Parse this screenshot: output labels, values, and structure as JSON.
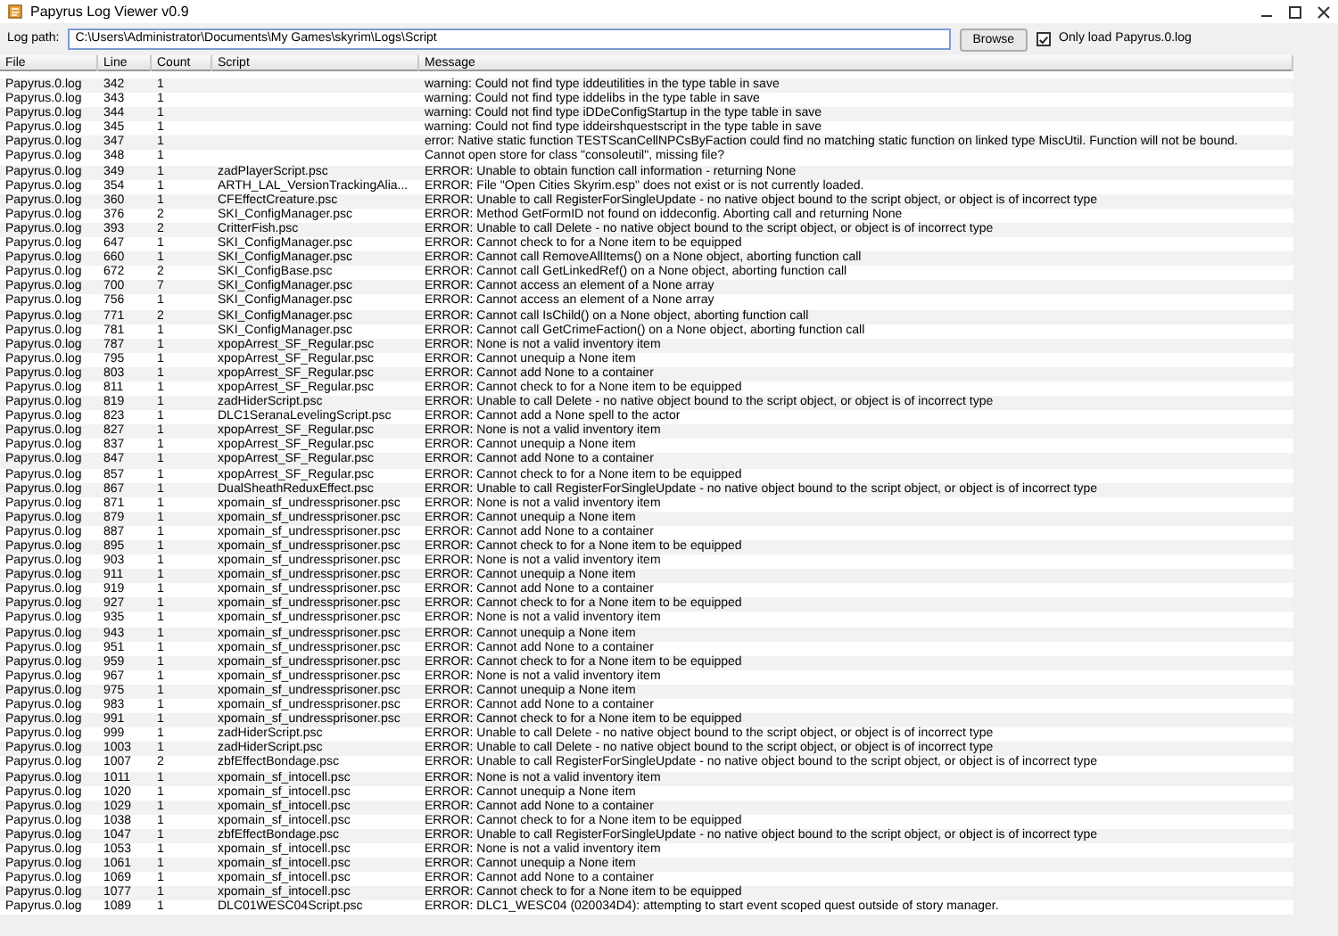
{
  "window": {
    "title": "Papyrus Log Viewer v0.9"
  },
  "toolbar": {
    "label": "Log path:",
    "path": "C:\\Users\\Administrator\\Documents\\My Games\\skyrim\\Logs\\Script",
    "browse": "Browse",
    "only_load": {
      "label": "Only load Papyrus.0.log",
      "checked": true
    }
  },
  "table": {
    "columns": [
      "File",
      "Line",
      "Count",
      "Script",
      "Message"
    ],
    "rows": [
      {
        "file": "Papyrus.0.log",
        "line": "342",
        "count": "1",
        "message": "warning: Could not find type iddeutilities in the type table in save"
      },
      {
        "file": "Papyrus.0.log",
        "line": "343",
        "count": "1",
        "message": "warning: Could not find type iddelibs in the type table in save"
      },
      {
        "file": "Papyrus.0.log",
        "line": "344",
        "count": "1",
        "message": "warning: Could not find type iDDeConfigStartup in the type table in save"
      },
      {
        "file": "Papyrus.0.log",
        "line": "345",
        "count": "1",
        "message": "warning: Could not find type iddeirshquestscript in the type table in save"
      },
      {
        "file": "Papyrus.0.log",
        "line": "347",
        "count": "1",
        "message": "error: Native static function TESTScanCellNPCsByFaction could find no matching static function on linked type MiscUtil. Function will not be bound."
      },
      {
        "file": "Papyrus.0.log",
        "line": "348",
        "count": "1",
        "message": "Cannot open store for class \"consoleutil\", missing file?"
      },
      {
        "file": "Papyrus.0.log",
        "line": "349",
        "count": "1",
        "script": "zadPlayerScript.psc",
        "message": "ERROR: Unable to obtain function call information - returning None"
      },
      {
        "file": "Papyrus.0.log",
        "line": "354",
        "count": "1",
        "script": "ARTH_LAL_VersionTrackingAlia...",
        "message": "ERROR: File \"Open Cities Skyrim.esp\" does not exist or is not currently loaded."
      },
      {
        "file": "Papyrus.0.log",
        "line": "360",
        "count": "1",
        "script": "CFEffectCreature.psc",
        "message": "ERROR: Unable to call RegisterForSingleUpdate - no native object bound to the script object, or object is of incorrect type"
      },
      {
        "file": "Papyrus.0.log",
        "line": "376",
        "count": "2",
        "script": "SKI_ConfigManager.psc",
        "message": "ERROR: Method GetFormID not found on iddeconfig. Aborting call and returning None"
      },
      {
        "file": "Papyrus.0.log",
        "line": "393",
        "count": "2",
        "script": "CritterFish.psc",
        "message": "ERROR: Unable to call Delete - no native object bound to the script object, or object is of incorrect type"
      },
      {
        "file": "Papyrus.0.log",
        "line": "647",
        "count": "1",
        "script": "SKI_ConfigManager.psc",
        "message": "ERROR: Cannot check to for a None item to be equipped"
      },
      {
        "file": "Papyrus.0.log",
        "line": "660",
        "count": "1",
        "script": "SKI_ConfigManager.psc",
        "message": "ERROR: Cannot call RemoveAllItems() on a None object, aborting function call"
      },
      {
        "file": "Papyrus.0.log",
        "line": "672",
        "count": "2",
        "script": "SKI_ConfigBase.psc",
        "message": "ERROR: Cannot call GetLinkedRef() on a None object, aborting function call"
      },
      {
        "file": "Papyrus.0.log",
        "line": "700",
        "count": "7",
        "script": "SKI_ConfigManager.psc",
        "message": "ERROR: Cannot access an element of a None array"
      },
      {
        "file": "Papyrus.0.log",
        "line": "756",
        "count": "1",
        "script": "SKI_ConfigManager.psc",
        "message": "ERROR: Cannot access an element of a None array"
      },
      {
        "file": "Papyrus.0.log",
        "line": "771",
        "count": "2",
        "script": "SKI_ConfigManager.psc",
        "message": "ERROR: Cannot call IsChild() on a None object, aborting function call"
      },
      {
        "file": "Papyrus.0.log",
        "line": "781",
        "count": "1",
        "script": "SKI_ConfigManager.psc",
        "message": "ERROR: Cannot call GetCrimeFaction() on a None object, aborting function call"
      },
      {
        "file": "Papyrus.0.log",
        "line": "787",
        "count": "1",
        "script": "xpopArrest_SF_Regular.psc",
        "message": "ERROR: None is not a valid inventory item"
      },
      {
        "file": "Papyrus.0.log",
        "line": "795",
        "count": "1",
        "script": "xpopArrest_SF_Regular.psc",
        "message": "ERROR: Cannot unequip a None item"
      },
      {
        "file": "Papyrus.0.log",
        "line": "803",
        "count": "1",
        "script": "xpopArrest_SF_Regular.psc",
        "message": "ERROR: Cannot add None to a container"
      },
      {
        "file": "Papyrus.0.log",
        "line": "811",
        "count": "1",
        "script": "xpopArrest_SF_Regular.psc",
        "message": "ERROR: Cannot check to for a None item to be equipped"
      },
      {
        "file": "Papyrus.0.log",
        "line": "819",
        "count": "1",
        "script": "zadHiderScript.psc",
        "message": "ERROR: Unable to call Delete - no native object bound to the script object, or object is of incorrect type"
      },
      {
        "file": "Papyrus.0.log",
        "line": "823",
        "count": "1",
        "script": "DLC1SeranaLevelingScript.psc",
        "message": "ERROR: Cannot add a None spell to the actor"
      },
      {
        "file": "Papyrus.0.log",
        "line": "827",
        "count": "1",
        "script": "xpopArrest_SF_Regular.psc",
        "message": "ERROR: None is not a valid inventory item"
      },
      {
        "file": "Papyrus.0.log",
        "line": "837",
        "count": "1",
        "script": "xpopArrest_SF_Regular.psc",
        "message": "ERROR: Cannot unequip a None item"
      },
      {
        "file": "Papyrus.0.log",
        "line": "847",
        "count": "1",
        "script": "xpopArrest_SF_Regular.psc",
        "message": "ERROR: Cannot add None to a container"
      },
      {
        "file": "Papyrus.0.log",
        "line": "857",
        "count": "1",
        "script": "xpopArrest_SF_Regular.psc",
        "message": "ERROR: Cannot check to for a None item to be equipped"
      },
      {
        "file": "Papyrus.0.log",
        "line": "867",
        "count": "1",
        "script": "DualSheathReduxEffect.psc",
        "message": "ERROR: Unable to call RegisterForSingleUpdate - no native object bound to the script object, or object is of incorrect type"
      },
      {
        "file": "Papyrus.0.log",
        "line": "871",
        "count": "1",
        "script": "xpomain_sf_undressprisoner.psc",
        "message": "ERROR: None is not a valid inventory item"
      },
      {
        "file": "Papyrus.0.log",
        "line": "879",
        "count": "1",
        "script": "xpomain_sf_undressprisoner.psc",
        "message": "ERROR: Cannot unequip a None item"
      },
      {
        "file": "Papyrus.0.log",
        "line": "887",
        "count": "1",
        "script": "xpomain_sf_undressprisoner.psc",
        "message": "ERROR: Cannot add None to a container"
      },
      {
        "file": "Papyrus.0.log",
        "line": "895",
        "count": "1",
        "script": "xpomain_sf_undressprisoner.psc",
        "message": "ERROR: Cannot check to for a None item to be equipped"
      },
      {
        "file": "Papyrus.0.log",
        "line": "903",
        "count": "1",
        "script": "xpomain_sf_undressprisoner.psc",
        "message": "ERROR: None is not a valid inventory item"
      },
      {
        "file": "Papyrus.0.log",
        "line": "911",
        "count": "1",
        "script": "xpomain_sf_undressprisoner.psc",
        "message": "ERROR: Cannot unequip a None item"
      },
      {
        "file": "Papyrus.0.log",
        "line": "919",
        "count": "1",
        "script": "xpomain_sf_undressprisoner.psc",
        "message": "ERROR: Cannot add None to a container"
      },
      {
        "file": "Papyrus.0.log",
        "line": "927",
        "count": "1",
        "script": "xpomain_sf_undressprisoner.psc",
        "message": "ERROR: Cannot check to for a None item to be equipped"
      },
      {
        "file": "Papyrus.0.log",
        "line": "935",
        "count": "1",
        "script": "xpomain_sf_undressprisoner.psc",
        "message": "ERROR: None is not a valid inventory item"
      },
      {
        "file": "Papyrus.0.log",
        "line": "943",
        "count": "1",
        "script": "xpomain_sf_undressprisoner.psc",
        "message": "ERROR: Cannot unequip a None item"
      },
      {
        "file": "Papyrus.0.log",
        "line": "951",
        "count": "1",
        "script": "xpomain_sf_undressprisoner.psc",
        "message": "ERROR: Cannot add None to a container"
      },
      {
        "file": "Papyrus.0.log",
        "line": "959",
        "count": "1",
        "script": "xpomain_sf_undressprisoner.psc",
        "message": "ERROR: Cannot check to for a None item to be equipped"
      },
      {
        "file": "Papyrus.0.log",
        "line": "967",
        "count": "1",
        "script": "xpomain_sf_undressprisoner.psc",
        "message": "ERROR: None is not a valid inventory item"
      },
      {
        "file": "Papyrus.0.log",
        "line": "975",
        "count": "1",
        "script": "xpomain_sf_undressprisoner.psc",
        "message": "ERROR: Cannot unequip a None item"
      },
      {
        "file": "Papyrus.0.log",
        "line": "983",
        "count": "1",
        "script": "xpomain_sf_undressprisoner.psc",
        "message": "ERROR: Cannot add None to a container"
      },
      {
        "file": "Papyrus.0.log",
        "line": "991",
        "count": "1",
        "script": "xpomain_sf_undressprisoner.psc",
        "message": "ERROR: Cannot check to for a None item to be equipped"
      },
      {
        "file": "Papyrus.0.log",
        "line": "999",
        "count": "1",
        "script": "zadHiderScript.psc",
        "message": "ERROR: Unable to call Delete - no native object bound to the script object, or object is of incorrect type"
      },
      {
        "file": "Papyrus.0.log",
        "line": "1003",
        "count": "1",
        "script": "zadHiderScript.psc",
        "message": "ERROR: Unable to call Delete - no native object bound to the script object, or object is of incorrect type"
      },
      {
        "file": "Papyrus.0.log",
        "line": "1007",
        "count": "2",
        "script": "zbfEffectBondage.psc",
        "message": "ERROR: Unable to call RegisterForSingleUpdate - no native object bound to the script object, or object is of incorrect type"
      },
      {
        "file": "Papyrus.0.log",
        "line": "1011",
        "count": "1",
        "script": "xpomain_sf_intocell.psc",
        "message": "ERROR: None is not a valid inventory item"
      },
      {
        "file": "Papyrus.0.log",
        "line": "1020",
        "count": "1",
        "script": "xpomain_sf_intocell.psc",
        "message": "ERROR: Cannot unequip a None item"
      },
      {
        "file": "Papyrus.0.log",
        "line": "1029",
        "count": "1",
        "script": "xpomain_sf_intocell.psc",
        "message": "ERROR: Cannot add None to a container"
      },
      {
        "file": "Papyrus.0.log",
        "line": "1038",
        "count": "1",
        "script": "xpomain_sf_intocell.psc",
        "message": "ERROR: Cannot check to for a None item to be equipped"
      },
      {
        "file": "Papyrus.0.log",
        "line": "1047",
        "count": "1",
        "script": "zbfEffectBondage.psc",
        "message": "ERROR: Unable to call RegisterForSingleUpdate - no native object bound to the script object, or object is of incorrect type"
      },
      {
        "file": "Papyrus.0.log",
        "line": "1053",
        "count": "1",
        "script": "xpomain_sf_intocell.psc",
        "message": "ERROR: None is not a valid inventory item"
      },
      {
        "file": "Papyrus.0.log",
        "line": "1061",
        "count": "1",
        "script": "xpomain_sf_intocell.psc",
        "message": "ERROR: Cannot unequip a None item"
      },
      {
        "file": "Papyrus.0.log",
        "line": "1069",
        "count": "1",
        "script": "xpomain_sf_intocell.psc",
        "message": "ERROR: Cannot add None to a container"
      },
      {
        "file": "Papyrus.0.log",
        "line": "1077",
        "count": "1",
        "script": "xpomain_sf_intocell.psc",
        "message": "ERROR: Cannot check to for a None item to be equipped"
      },
      {
        "file": "Papyrus.0.log",
        "line": "1089",
        "count": "1",
        "script": "DLC01WESC04Script.psc",
        "message": "ERROR: DLC1_WESC04 (020034D4): attempting to start event scoped quest outside of story manager."
      }
    ]
  }
}
